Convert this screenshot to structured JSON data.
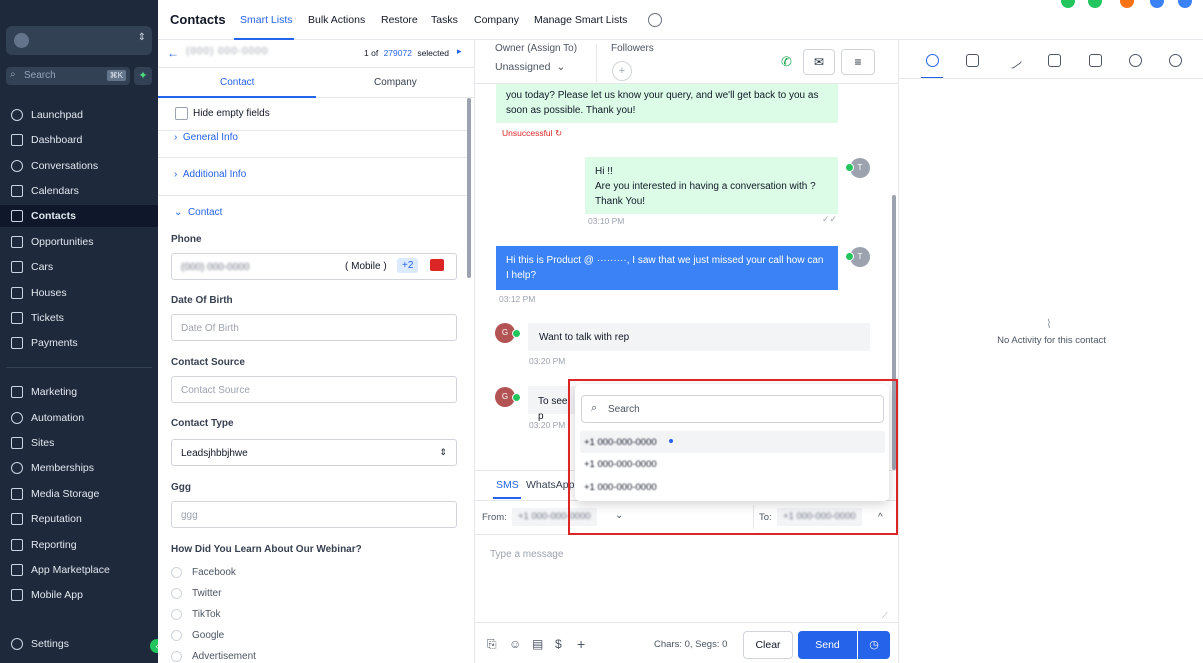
{
  "sidebar": {
    "search_placeholder": "Search",
    "search_shortcut": "⌘K",
    "items_top": [
      {
        "label": "Launchpad",
        "icon": "rocket-icon"
      },
      {
        "label": "Dashboard",
        "icon": "grid-icon"
      },
      {
        "label": "Conversations",
        "icon": "chat-icon"
      },
      {
        "label": "Calendars",
        "icon": "calendar-icon"
      },
      {
        "label": "Contacts",
        "icon": "contacts-icon",
        "active": true
      },
      {
        "label": "Opportunities",
        "icon": "funnel-icon"
      },
      {
        "label": "Cars",
        "icon": "box-icon"
      },
      {
        "label": "Houses",
        "icon": "box-icon"
      },
      {
        "label": "Tickets",
        "icon": "ticket-icon"
      },
      {
        "label": "Payments",
        "icon": "receipt-icon"
      }
    ],
    "items_bottom": [
      {
        "label": "Marketing",
        "icon": "send-icon"
      },
      {
        "label": "Automation",
        "icon": "automation-icon"
      },
      {
        "label": "Sites",
        "icon": "globe-icon"
      },
      {
        "label": "Memberships",
        "icon": "membership-icon"
      },
      {
        "label": "Media Storage",
        "icon": "image-icon"
      },
      {
        "label": "Reputation",
        "icon": "star-icon"
      },
      {
        "label": "Reporting",
        "icon": "trend-icon"
      },
      {
        "label": "App Marketplace",
        "icon": "apps-icon"
      },
      {
        "label": "Mobile App",
        "icon": "phone-icon"
      }
    ],
    "settings_label": "Settings"
  },
  "topbar": {
    "title": "Contacts",
    "nav": [
      "Smart Lists",
      "Bulk Actions",
      "Restore",
      "Tasks",
      "Company",
      "Manage Smart Lists"
    ]
  },
  "contact_panel": {
    "phone_redacted": "(000) 000-0000",
    "count_of": "1 of",
    "count_total": "279072",
    "count_suffix": "selected",
    "tabs": [
      "Contact",
      "Company"
    ],
    "hide_empty": "Hide empty fields",
    "sections": [
      "General Info",
      "Additional Info",
      "Contact"
    ],
    "phone_label": "Phone",
    "phone_type": "( Mobile )",
    "phone_more": "+2",
    "dob_label": "Date Of Birth",
    "dob_placeholder": "Date Of Birth",
    "source_label": "Contact Source",
    "source_placeholder": "Contact Source",
    "type_label": "Contact Type",
    "type_value": "Leadsjhbbjhwe",
    "ggg_label": "Ggg",
    "ggg_placeholder": "ggg",
    "webinar_label": "How Did You Learn About Our Webinar?",
    "webinar_options": [
      "Facebook",
      "Twitter",
      "TikTok",
      "Google",
      "Advertisement"
    ]
  },
  "conversation": {
    "owner_label": "Owner (Assign To)",
    "owner_value": "Unassigned",
    "followers_label": "Followers",
    "msg1_text": "you today? Please let us know your query, and we'll get back to you as soon as possible. Thank you!",
    "msg1_status": "Unsuccessful",
    "msg2_text": [
      "Hi !!",
      "Are you interested in having a conversation with ?",
      "Thank You!"
    ],
    "msg2_time": "03:10 PM",
    "msg3_text": "Hi this is Product @ ·········, I saw that we just missed your call how can I help?",
    "msg3_time": "03:12 PM",
    "msg4_text": "Want to talk with rep",
    "msg4_time": "03:20 PM",
    "msg5_text": "To see p",
    "msg5_time": "03:20 PM",
    "channel_tabs": [
      "SMS",
      "WhatsApp"
    ],
    "from_label": "From:",
    "from_value": "+1 000-000-0000",
    "to_label": "To:",
    "to_value": "+1 000-000-0000",
    "compose_placeholder": "Type a message",
    "chars_segs": "Chars: 0, Segs: 0",
    "clear_label": "Clear",
    "send_label": "Send"
  },
  "phone_dropdown": {
    "search_placeholder": "Search",
    "options": [
      "+1 000-000-0000",
      "+1 000-000-0000",
      "+1 000-000-0000"
    ]
  },
  "right_panel": {
    "empty_text": "No Activity for this contact"
  },
  "colors": {
    "primary": "#2563eb",
    "sidebar_bg": "#1e293b",
    "bubble_green": "#dcfce7",
    "bubble_blue": "#3b82f6",
    "highlight_red": "#dc2626"
  }
}
